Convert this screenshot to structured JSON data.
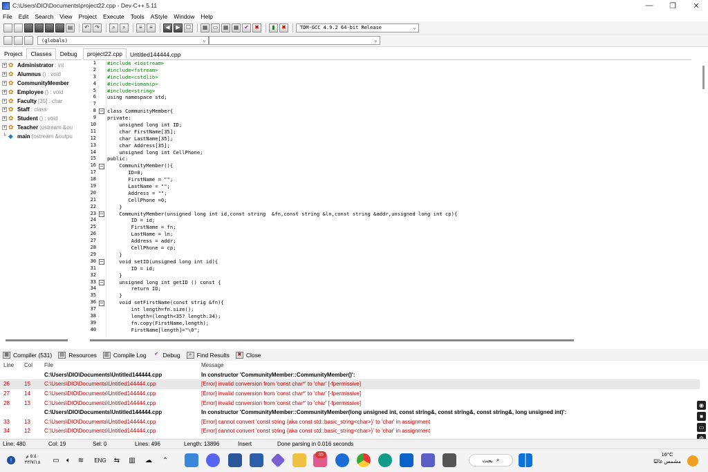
{
  "window": {
    "title": "C:\\Users\\DIO\\Documents\\project22.cpp - Dev-C++ 5.11",
    "min": "—",
    "max": "❐",
    "close": "✕"
  },
  "menu": [
    "File",
    "Edit",
    "Search",
    "View",
    "Project",
    "Execute",
    "Tools",
    "AStyle",
    "Window",
    "Help"
  ],
  "toolbar": {
    "compiler": "TDM-GCC 4.9.2 64-bit Release",
    "scope": "(globals)"
  },
  "left_tabs": [
    "Project",
    "Classes",
    "Debug"
  ],
  "class_tree": [
    {
      "pm": "+",
      "name": "Administrator",
      "type": ": int"
    },
    {
      "pm": "+",
      "name": "Alumnus",
      "type": "() : void"
    },
    {
      "pm": "+",
      "name": "CommunityMember",
      "type": ""
    },
    {
      "pm": "+",
      "name": "Employee",
      "type": "() : void"
    },
    {
      "pm": "+",
      "name": "Faculty",
      "type": "[35] : char"
    },
    {
      "pm": "+",
      "name": "Staff",
      "type": ": class"
    },
    {
      "pm": "+",
      "name": "Student",
      "type": "() : void"
    },
    {
      "pm": "+",
      "name": "Teacher",
      "type": "(ostream &ou"
    },
    {
      "pm": "",
      "name": "main",
      "type": "(ostream &outpu"
    }
  ],
  "editor_tabs": [
    "project22.cpp",
    "Untitled144444.cpp"
  ],
  "code": [
    {
      "n": "1",
      "t": "#include <iostream>"
    },
    {
      "n": "2",
      "t": "#include<fstream>"
    },
    {
      "n": "3",
      "t": "#include<cstdlib>"
    },
    {
      "n": "4",
      "t": "#include<iomanip>"
    },
    {
      "n": "5",
      "t": "#include<string>"
    },
    {
      "n": "6",
      "t": "using namespace std;"
    },
    {
      "n": "7",
      "t": ""
    },
    {
      "n": "8",
      "t": "class CommunityMember{"
    },
    {
      "n": "9",
      "t": "private:"
    },
    {
      "n": "10",
      "t": "    unsigned long int ID;"
    },
    {
      "n": "11",
      "t": "    char FirstName[35];"
    },
    {
      "n": "12",
      "t": "    char LastName[35];"
    },
    {
      "n": "13",
      "t": "    char Address[35];"
    },
    {
      "n": "14",
      "t": "    unsigned long int CellPhone;"
    },
    {
      "n": "15",
      "t": "public:"
    },
    {
      "n": "16",
      "t": "    CommunityMember(){"
    },
    {
      "n": "17",
      "t": "       ID=0;"
    },
    {
      "n": "18",
      "t": "       FirstName = \"\";"
    },
    {
      "n": "19",
      "t": "       LastName = \"\";"
    },
    {
      "n": "20",
      "t": "       Address = \"\";"
    },
    {
      "n": "21",
      "t": "       CellPhone =0;"
    },
    {
      "n": "22",
      "t": "    }"
    },
    {
      "n": "23",
      "t": "    CommunityMember(unsigned long int id,const string  &fn,const string &ln,const string &addr,unsigned long int cp){"
    },
    {
      "n": "24",
      "t": "        ID = id;"
    },
    {
      "n": "25",
      "t": "        FirstName = fn;"
    },
    {
      "n": "26",
      "t": "        LastName = ln;"
    },
    {
      "n": "27",
      "t": "        Address = addr;"
    },
    {
      "n": "28",
      "t": "        CellPhone = cp;"
    },
    {
      "n": "29",
      "t": "    }"
    },
    {
      "n": "30",
      "t": "    void setID(unsigned long int id){"
    },
    {
      "n": "31",
      "t": "        ID = id;"
    },
    {
      "n": "32",
      "t": "    }"
    },
    {
      "n": "33",
      "t": "    unsigned long int getID () const {"
    },
    {
      "n": "34",
      "t": "        return ID;"
    },
    {
      "n": "35",
      "t": "    }"
    },
    {
      "n": "36",
      "t": "    void setFirstName(const strig &fn){"
    },
    {
      "n": "37",
      "t": "        int length=fn.size();"
    },
    {
      "n": "38",
      "t": "        length=(length<35? length:34);"
    },
    {
      "n": "39",
      "t": "        fn.copy(FirstName,length);"
    },
    {
      "n": "40",
      "t": "        FirstName[length]=\"\\0\";"
    }
  ],
  "bottom_tabs": [
    "Compiler (531)",
    "Resources",
    "Compile Log",
    "Debug",
    "Find Results",
    "Close"
  ],
  "messages": {
    "headers": [
      "Line",
      "Col",
      "File",
      "Message"
    ],
    "rows": [
      {
        "kind": "hd",
        "line": "",
        "col": "",
        "file": "C:\\Users\\DIO\\Documents\\Untitled144444.cpp",
        "msg": "In constructor 'CommunityMember::CommunityMember()':"
      },
      {
        "kind": "sel",
        "line": "26",
        "col": "15",
        "file": "C:\\Users\\DIO\\Documents\\Untitled144444.cpp",
        "msg": "[Error] invalid conversion from 'const char*' to 'char' [-fpermissive]"
      },
      {
        "kind": "err",
        "line": "27",
        "col": "14",
        "file": "C:\\Users\\DIO\\Documents\\Untitled144444.cpp",
        "msg": "[Error] invalid conversion from 'const char*' to 'char' [-fpermissive]"
      },
      {
        "kind": "err",
        "line": "28",
        "col": "13",
        "file": "C:\\Users\\DIO\\Documents\\Untitled144444.cpp",
        "msg": "[Error] invalid conversion from 'const char*' to 'char' [-fpermissive]"
      },
      {
        "kind": "hd",
        "line": "",
        "col": "",
        "file": "C:\\Users\\DIO\\Documents\\Untitled144444.cpp",
        "msg": "In constructor 'CommunityMember::CommunityMember(long unsigned int, const string&, const string&, const string&, long unsigned int)':"
      },
      {
        "kind": "err",
        "line": "33",
        "col": "13",
        "file": "C:\\Users\\DIO\\Documents\\Untitled144444.cpp",
        "msg": "[Error] cannot convert 'const string {aka const std::basic_string<char>}' to 'char' in assignment"
      },
      {
        "kind": "err",
        "line": "34",
        "col": "12",
        "file": "C:\\Users\\DIO\\Documents\\Untitled144444.cpp",
        "msg": "[Error] cannot convert 'const string {aka const std::basic_string<char>}' to 'char' in assignment"
      }
    ]
  },
  "status": {
    "line": "Line:  480",
    "col": "Col:  19",
    "sel": "Sel:  0",
    "lines": "Lines:  496",
    "length": "Length: 13896",
    "mode": "Insert",
    "parse": "Done parsing in 0.016 seconds"
  },
  "taskbar": {
    "clock_time": "٥:٤٠ م",
    "clock_date": "٢٢/٧/١٨",
    "lang": "ENG",
    "search": "بحث",
    "weather_temp": "16°C",
    "weather_desc": "مشمس غالبًا",
    "badge": "35"
  },
  "colors": {
    "preprocessor": "#008000",
    "error": "#c00000",
    "accent": "#0067c0"
  }
}
